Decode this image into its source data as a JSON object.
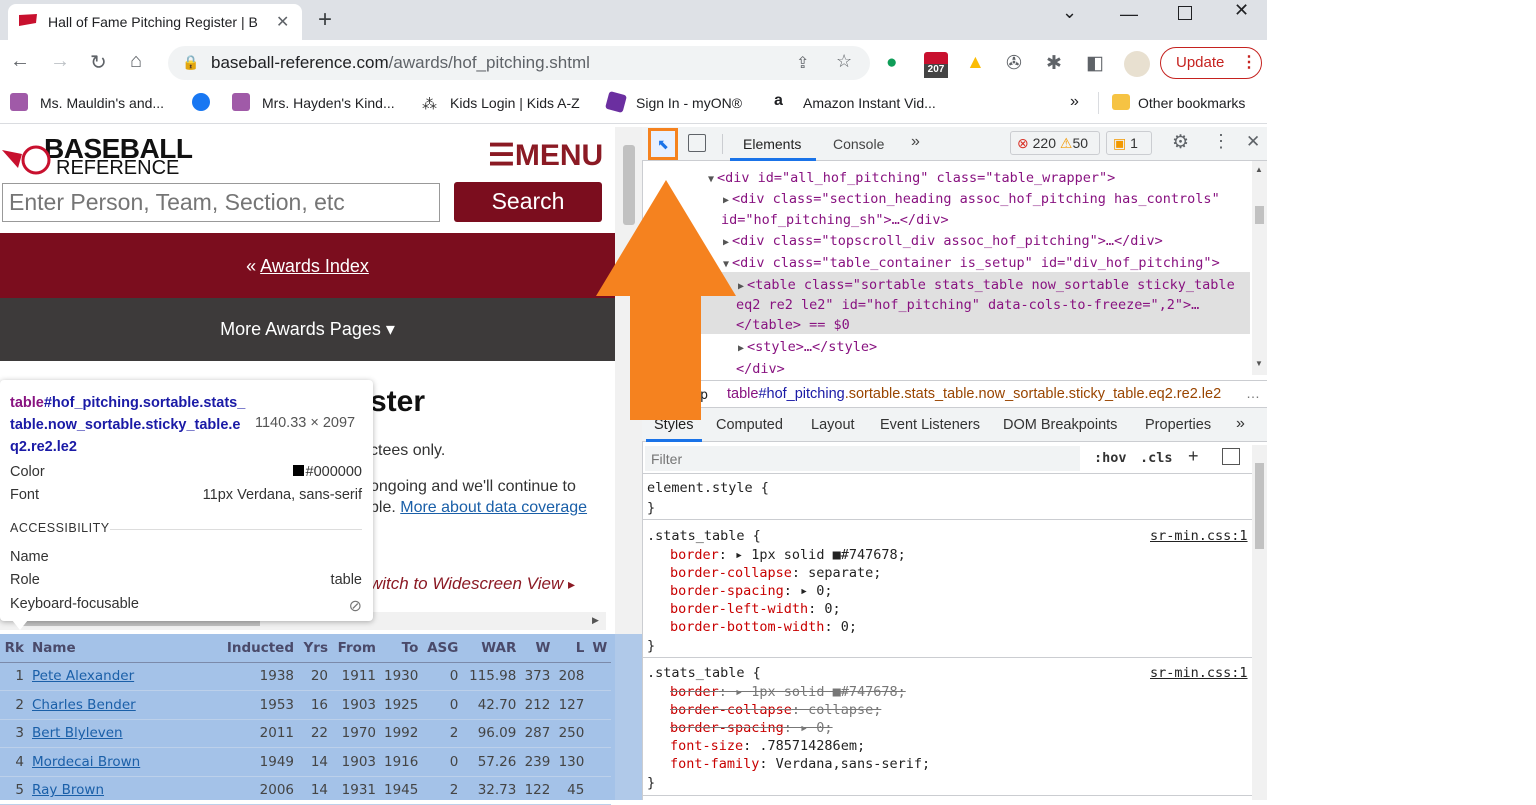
{
  "browser": {
    "tab_title": "Hall of Fame Pitching Register | B",
    "url_host": "baseball-reference.com",
    "url_path": "/awards/hof_pitching.shtml",
    "update_label": "Update",
    "ext_badge": "207",
    "bookmarks": [
      {
        "label": "Ms. Mauldin's and..."
      },
      {
        "label": ""
      },
      {
        "label": "Mrs. Hayden's Kind..."
      },
      {
        "label": "Kids Login | Kids A-Z"
      },
      {
        "label": "Sign In - myON®"
      },
      {
        "label": "Amazon Instant Vid..."
      }
    ],
    "bookmarks_more": "»",
    "other_bookmarks": "Other bookmarks"
  },
  "site": {
    "logo_line1": "BASEBALL",
    "logo_line2": "REFERENCE",
    "menu_label": "☰MENU",
    "search_placeholder": "Enter Person, Team, Section, etc",
    "search_button": "Search",
    "awards_prefix": "« ",
    "awards_link": "Awards Index",
    "more_awards": "More Awards Pages ▾",
    "title_partial": "ster",
    "line1": "ctees only.",
    "line2": "ongoing and we'll continue to",
    "line3_prefix": "ble. ",
    "line3_link": "More about data coverage",
    "widescreen": "witch to Widescreen View",
    "widescreen_arrow": "▸"
  },
  "table": {
    "headers": [
      "Rk",
      "Name",
      "Inducted",
      "Yrs",
      "From",
      "To",
      "ASG",
      "WAR",
      "W",
      "L",
      "W"
    ],
    "rows": [
      [
        "1",
        "Pete Alexander",
        "1938",
        "20",
        "1911",
        "1930",
        "0",
        "115.98",
        "373",
        "208"
      ],
      [
        "2",
        "Charles Bender",
        "1953",
        "16",
        "1903",
        "1925",
        "0",
        "42.70",
        "212",
        "127"
      ],
      [
        "3",
        "Bert Blyleven",
        "2011",
        "22",
        "1970",
        "1992",
        "2",
        "96.09",
        "287",
        "250"
      ],
      [
        "4",
        "Mordecai Brown",
        "1949",
        "14",
        "1903",
        "1916",
        "0",
        "57.26",
        "239",
        "130"
      ],
      [
        "5",
        "Ray Brown",
        "2006",
        "14",
        "1931",
        "1945",
        "2",
        "32.73",
        "122",
        "45"
      ]
    ]
  },
  "tooltip": {
    "selector_tag": "table",
    "selector_rest": "#hof_pitching.sortable.stats_table.now_sortable.sticky_table.eq2.re2.le2",
    "dimensions": "1140.33 × 2097",
    "color_label": "Color",
    "color_value": "#000000",
    "font_label": "Font",
    "font_value": "11px Verdana, sans-serif",
    "accessibility": "ACCESSIBILITY",
    "name_label": "Name",
    "role_label": "Role",
    "role_value": "table",
    "kf_label": "Keyboard-focusable"
  },
  "devtools": {
    "tabs": [
      "Elements",
      "Console"
    ],
    "more": "»",
    "errors": "220",
    "warnings": "50",
    "issues": "1",
    "dom": [
      {
        "indent": 0,
        "tri": "▼",
        "html": "<div id=\"all_hof_pitching\" class=\"table_wrapper\">"
      },
      {
        "indent": 1,
        "tri": "▶",
        "html": "<div class=\"section_heading assoc_hof_pitching has_controls\""
      },
      {
        "indent": -1,
        "tri": "",
        "html": "id=\"hof_pitching_sh\">…</div>"
      },
      {
        "indent": 1,
        "tri": "▶",
        "html": "<div class=\"topscroll_div assoc_hof_pitching\">…</div>"
      },
      {
        "indent": 1,
        "tri": "▼",
        "html": "<div class=\"table_container is_setup\" id=\"div_hof_pitching\">"
      },
      {
        "indent": 2,
        "tri": "▶",
        "html": "<table class=\"sortable stats_table now_sortable sticky_table"
      },
      {
        "indent": 1.5,
        "tri": "",
        "html": "eq2 re2 le2\" id=\"hof_pitching\" data-cols-to-freeze=\",2\">…"
      },
      {
        "indent": 1.5,
        "tri": "",
        "html": "</table> == $0"
      },
      {
        "indent": 2,
        "tri": "▶",
        "html": "<style>…</style>"
      },
      {
        "indent": 1.5,
        "tri": "",
        "html": "</div>"
      }
    ],
    "breadcrumb_partial": "p",
    "breadcrumb_tag": "table",
    "breadcrumb_id": "#hof_pitching",
    "breadcrumb_classes": ".sortable.stats_table.now_sortable.sticky_table.eq2.re2.le2",
    "breadcrumb_more": "…",
    "subtabs": [
      "Styles",
      "Computed",
      "Layout",
      "Event Listeners",
      "DOM Breakpoints",
      "Properties"
    ],
    "filter_placeholder": "Filter",
    "hov": ":hov",
    "cls": ".cls",
    "plus": "+",
    "element_style": "element.style {",
    "close_brace": "}",
    "rule1_selector": ".stats_table {",
    "rule1_src": "sr-min.css:1",
    "rule1_props": [
      {
        "name": "border",
        "value": ": ▸ 1px solid ■#747678;"
      },
      {
        "name": "border-collapse",
        "value": ": separate;"
      },
      {
        "name": "border-spacing",
        "value": ": ▸ 0;"
      },
      {
        "name": "border-left-width",
        "value": ": 0;"
      },
      {
        "name": "border-bottom-width",
        "value": ": 0;"
      }
    ],
    "rule2_selector": ".stats_table {",
    "rule2_src": "sr-min.css:1",
    "rule2_props": [
      {
        "name": "border",
        "value": ": ▸ 1px solid ■#747678;",
        "struck": true
      },
      {
        "name": "border-collapse",
        "value": ": collapse;",
        "struck": true
      },
      {
        "name": "border-spacing",
        "value": ": ▸ 0;",
        "struck": true
      },
      {
        "name": "font-size",
        "value": ": .785714286em;",
        "struck": false
      },
      {
        "name": "font-family",
        "value": ": Verdana,sans-serif;",
        "struck": false
      }
    ]
  },
  "colors": {
    "brand_red": "#7b0d1e",
    "highlight": "#a4c2e8",
    "arrow": "#f5821f"
  }
}
